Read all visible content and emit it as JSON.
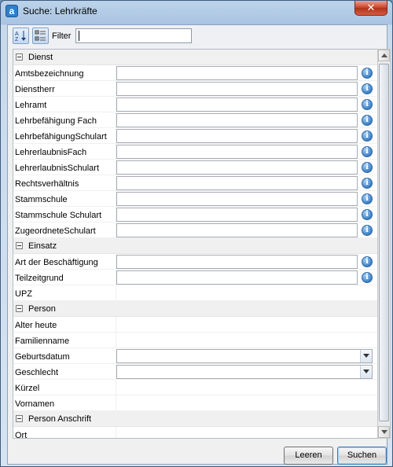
{
  "window": {
    "title": "Suche: Lehrkräfte",
    "app_icon_letter": "a",
    "close_glyph": "✕"
  },
  "toolbar": {
    "sort_alpha_icon": "sort-alphabetical-icon",
    "categorized_icon": "categorized-view-icon",
    "filter_label": "Filter",
    "filter_value": ""
  },
  "categories": [
    {
      "label": "Dienst",
      "properties": [
        {
          "label": "Amtsbezeichnung",
          "editor": "text",
          "info": true
        },
        {
          "label": "Dienstherr",
          "editor": "text",
          "info": true
        },
        {
          "label": "Lehramt",
          "editor": "text",
          "info": true
        },
        {
          "label": "Lehrbefähigung Fach",
          "editor": "text",
          "info": true
        },
        {
          "label": "LehrbefähigungSchulart",
          "editor": "text",
          "info": true
        },
        {
          "label": "LehrerlaubnisFach",
          "editor": "text",
          "info": true
        },
        {
          "label": "LehrerlaubnisSchulart",
          "editor": "text",
          "info": true
        },
        {
          "label": "Rechtsverhältnis",
          "editor": "text",
          "info": true
        },
        {
          "label": "Stammschule",
          "editor": "text",
          "info": true
        },
        {
          "label": "Stammschule Schulart",
          "editor": "text",
          "info": true
        },
        {
          "label": "ZugeordneteSchulart",
          "editor": "text",
          "info": true
        }
      ]
    },
    {
      "label": "Einsatz",
      "properties": [
        {
          "label": "Art der Beschäftigung",
          "editor": "text",
          "info": true
        },
        {
          "label": "Teilzeitgrund",
          "editor": "text",
          "info": true
        },
        {
          "label": "UPZ",
          "editor": "none",
          "info": false
        }
      ]
    },
    {
      "label": "Person",
      "properties": [
        {
          "label": "Alter heute",
          "editor": "none",
          "info": false
        },
        {
          "label": "Familienname",
          "editor": "none",
          "info": false
        },
        {
          "label": "Geburtsdatum",
          "editor": "select",
          "info": false
        },
        {
          "label": "Geschlecht",
          "editor": "select",
          "info": false
        },
        {
          "label": "Kürzel",
          "editor": "none",
          "info": false
        },
        {
          "label": "Vornamen",
          "editor": "none",
          "info": false
        }
      ]
    },
    {
      "label": "Person Anschrift",
      "properties": [
        {
          "label": "Ort",
          "editor": "none",
          "info": false
        }
      ]
    }
  ],
  "buttons": {
    "reset_label": "Leeren",
    "search_label": "Suchen"
  },
  "colors": {
    "info_blue": "#3d7fc4",
    "close_red": "#c7402a",
    "category_bg": "#f0f0f0"
  }
}
